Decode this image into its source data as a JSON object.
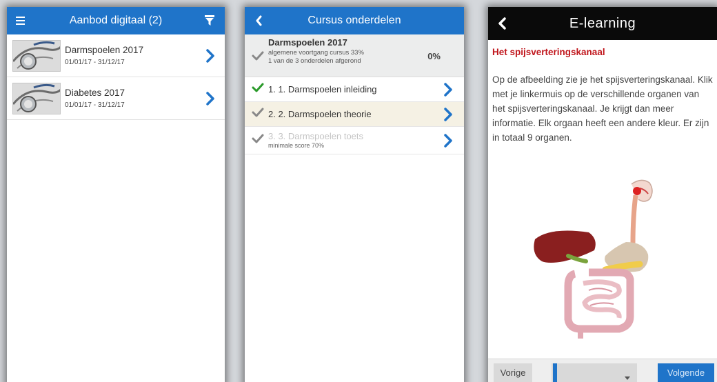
{
  "screen1": {
    "header": {
      "title": "Aanbod digitaal (2)",
      "menu_icon": "hamburger-icon",
      "filter_icon": "filter-icon"
    },
    "courses": [
      {
        "name": "Darmspoelen 2017",
        "date": "01/01/17 - 31/12/17",
        "thumb_icon": "stethoscope-icon"
      },
      {
        "name": "Diabetes 2017",
        "date": "01/01/17 - 31/12/17",
        "thumb_icon": "stethoscope-icon"
      }
    ]
  },
  "screen2": {
    "header": {
      "title": "Cursus onderdelen",
      "back_icon": "chevron-left-icon"
    },
    "summary": {
      "title": "Darmspoelen 2017",
      "progress_text": "algemene voortgang cursus 33%",
      "parts_text": "1 van de 3 onderdelen afgerond",
      "percent": "0%"
    },
    "parts": [
      {
        "label": "1. 1. Darmspoelen inleiding",
        "status": "completed",
        "subtext": ""
      },
      {
        "label": "2. 2. Darmspoelen theorie",
        "status": "current",
        "subtext": ""
      },
      {
        "label": "3. 3. Darmspoelen toets",
        "status": "locked",
        "subtext": "minimale score 70%"
      }
    ]
  },
  "screen3": {
    "header": {
      "title": "E-learning",
      "back_icon": "chevron-left-icon"
    },
    "heading": "Het spijsverteringskanaal",
    "body": "Op de afbeelding zie je het spijsverteringskanaal. Klik met je linkermuis op de verschillende organen van het spijsverteringskanaal. Je krijgt dan meer informatie. Elk orgaan heeft een andere kleur. Er zijn in totaal 9 organen.",
    "footer": {
      "prev_label": "Vorige",
      "next_label": "Volgende",
      "select_value": ""
    }
  },
  "colors": {
    "accent": "#1f74c9",
    "check_green": "#2a9a2a",
    "heading_red": "#c0161c"
  }
}
